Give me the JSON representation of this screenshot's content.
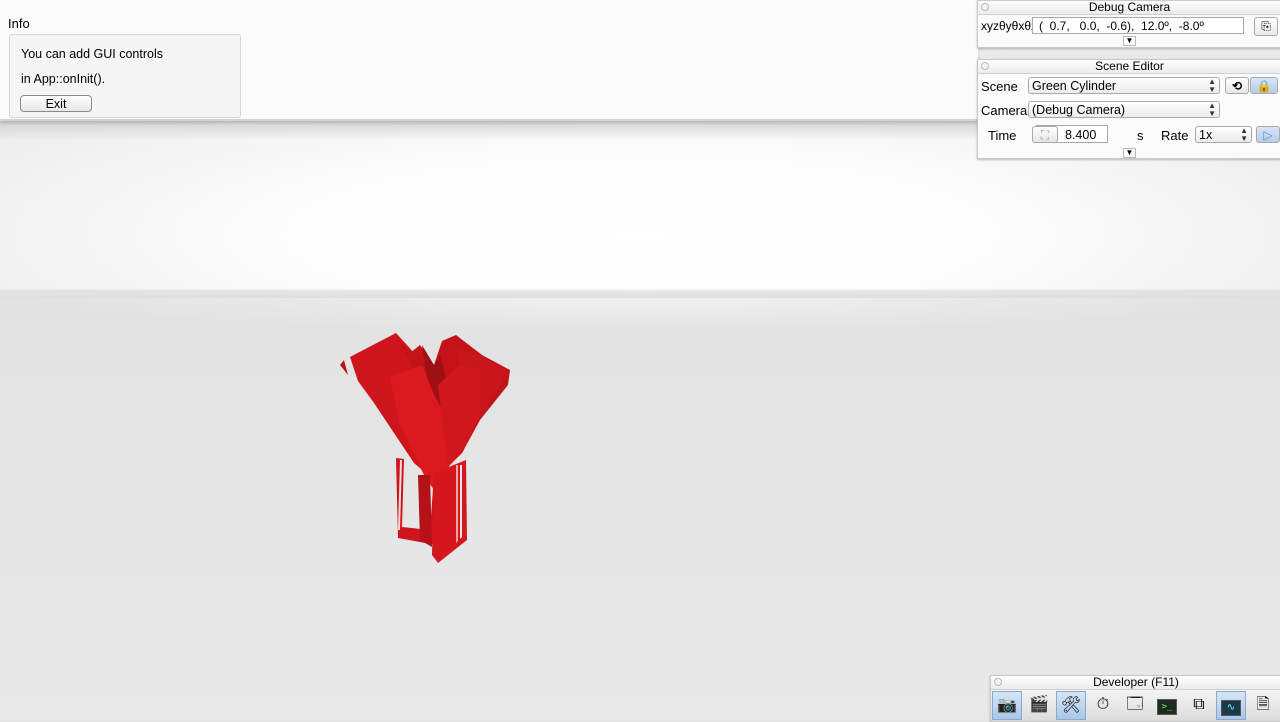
{
  "info": {
    "title": "Info",
    "line1": "You can add GUI controls",
    "line2": "in App::onInit().",
    "exit_label": "Exit"
  },
  "debug_camera": {
    "title": "Debug Camera",
    "xyz_label": "xyzθyθxθz",
    "value": "(  0.7,   0.0,  -0.6),  12.0º,  -8.0º"
  },
  "scene_editor": {
    "title": "Scene Editor",
    "scene_label": "Scene",
    "scene_value": "Green Cylinder",
    "camera_label": "Camera",
    "camera_value": "(Debug Camera)",
    "time_label": "Time",
    "time_value": "8.400",
    "time_unit": "s",
    "rate_label": "Rate",
    "rate_value": "1x"
  },
  "developer": {
    "title": "Developer (F11)",
    "tools": [
      "camera-icon",
      "clapperboard-icon",
      "wrench-screwdriver-icon",
      "stopwatch-icon",
      "new-window-icon",
      "console-icon",
      "scene-graph-icon",
      "profiler-icon",
      "document-icon"
    ]
  },
  "colors": {
    "model_red": "#d8161c",
    "accent_blue": "#bcd4f0"
  }
}
